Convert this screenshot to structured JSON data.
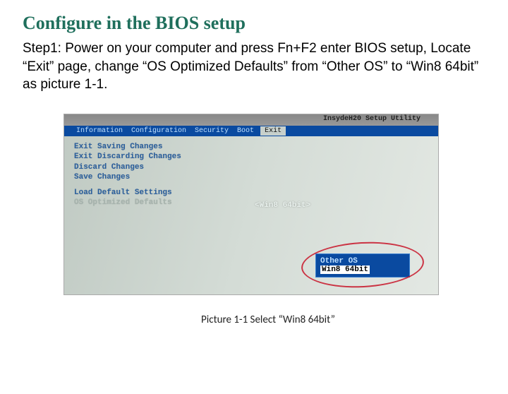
{
  "heading": "Configure in the BIOS setup",
  "instruction": "Step1: Power on your computer and press Fn+F2 enter BIOS setup, Locate “Exit” page, change “OS Optimized Defaults” from “Other OS” to “Win8 64bit” as picture 1-1.",
  "bios": {
    "utility_title": "InsydeH20 Setup Utility",
    "menubar": {
      "tabs": [
        "Information",
        "Configuration",
        "Security",
        "Boot",
        "Exit"
      ],
      "active_index": 4
    },
    "menu": {
      "exit_saving": "Exit Saving Changes",
      "exit_discarding": "Exit Discarding Changes",
      "discard": "Discard Changes",
      "save": "Save Changes",
      "load_defaults": "Load Default Settings",
      "os_optimized_label": "OS Optimized Defaults",
      "os_optimized_value": "<Win8 64bit>"
    },
    "popup": {
      "option1": "Other OS",
      "option2": "Win8 64bit"
    }
  },
  "caption": "Picture 1-1 Select “Win8 64bit”"
}
